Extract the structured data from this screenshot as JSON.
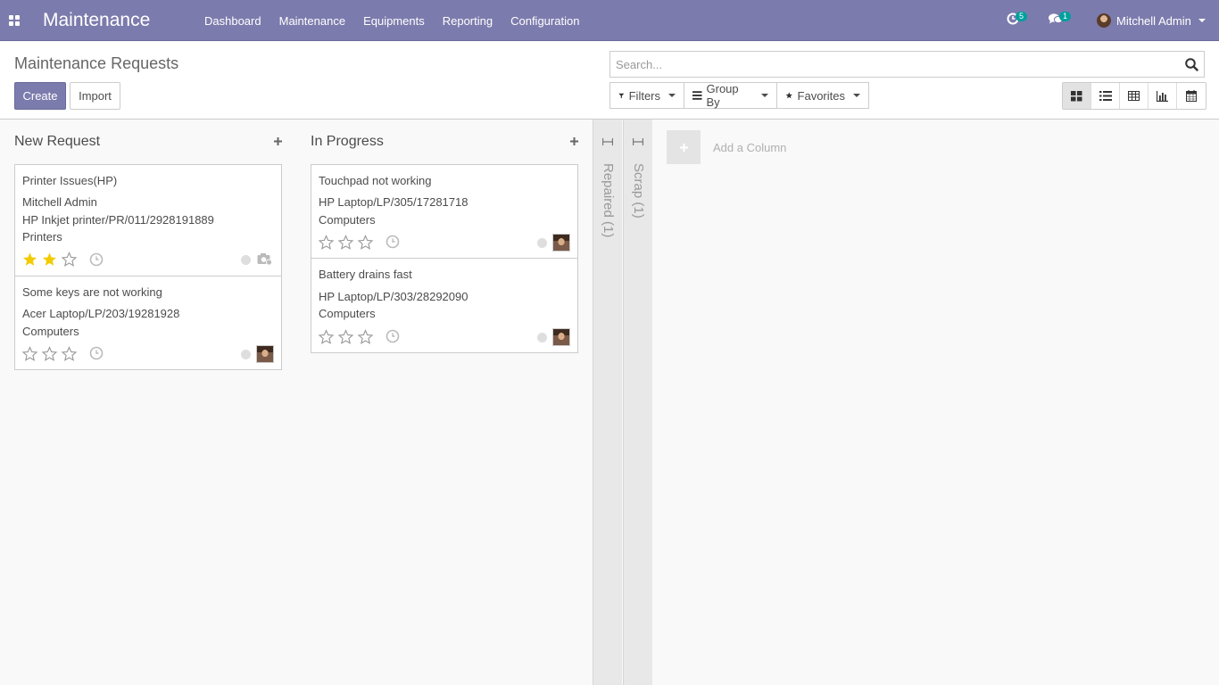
{
  "navbar": {
    "brand": "Maintenance",
    "menu": [
      "Dashboard",
      "Maintenance",
      "Equipments",
      "Reporting",
      "Configuration"
    ],
    "activity_count": "5",
    "messages_count": "1",
    "user_name": "Mitchell Admin"
  },
  "control_panel": {
    "title": "Maintenance Requests",
    "create_label": "Create",
    "import_label": "Import",
    "search_placeholder": "Search...",
    "filters_label": "Filters",
    "groupby_label": "Group By",
    "favorites_label": "Favorites",
    "views": [
      "kanban-icon",
      "list-icon",
      "pivot-icon",
      "graph-icon",
      "calendar-icon"
    ],
    "active_view": "kanban"
  },
  "kanban": {
    "columns": [
      {
        "title": "New Request",
        "cards": [
          {
            "title": "Printer Issues(HP)",
            "lines": [
              "Mitchell Admin",
              "HP Inkjet printer/PR/011/2928191889",
              "Printers"
            ],
            "priority": 2
          },
          {
            "title": "Some keys are not working",
            "lines": [
              "Acer Laptop/LP/203/19281928",
              "Computers"
            ],
            "priority": 0
          }
        ]
      },
      {
        "title": "In Progress",
        "cards": [
          {
            "title": "Touchpad not working",
            "lines": [
              "HP Laptop/LP/305/17281718",
              "Computers"
            ],
            "priority": 0
          },
          {
            "title": "Battery drains fast",
            "lines": [
              "HP Laptop/LP/303/28292090",
              "Computers"
            ],
            "priority": 0
          }
        ]
      }
    ],
    "folded_columns": [
      "Repaired (1)",
      "Scrap (1)"
    ],
    "add_column_label": "Add a Column"
  },
  "colors": {
    "brand": "#7c7bad",
    "star_on": "#f3cc00",
    "badge": "#00a09d"
  }
}
